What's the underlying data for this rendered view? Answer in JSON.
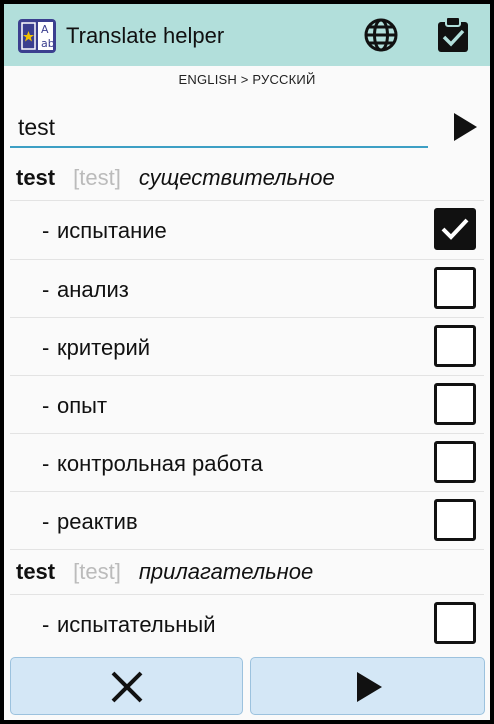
{
  "app": {
    "title": "Translate helper"
  },
  "language_pair": "ENGLISH > РУССКИЙ",
  "search": {
    "value": "test"
  },
  "entries": [
    {
      "word": "test",
      "transcription": "[test]",
      "part_of_speech": "существительное",
      "translations": [
        {
          "label": "испытание",
          "checked": true
        },
        {
          "label": "анализ",
          "checked": false
        },
        {
          "label": "критерий",
          "checked": false
        },
        {
          "label": "опыт",
          "checked": false
        },
        {
          "label": "контрольная работа",
          "checked": false
        },
        {
          "label": "реактив",
          "checked": false
        }
      ]
    },
    {
      "word": "test",
      "transcription": "[test]",
      "part_of_speech": "прилагательное",
      "translations": [
        {
          "label": "испытательный",
          "checked": false
        }
      ]
    }
  ],
  "dash": "-",
  "icons": {
    "logo": "dictionary-book-icon",
    "language": "globe-icon",
    "selection": "clipboard-check-icon",
    "translate": "play-icon",
    "cancel": "close-icon",
    "proceed": "play-icon"
  },
  "colors": {
    "appbar": "#b2dfdb",
    "input_underline": "#3d9fc4",
    "button_bg": "#d4e7f6"
  }
}
